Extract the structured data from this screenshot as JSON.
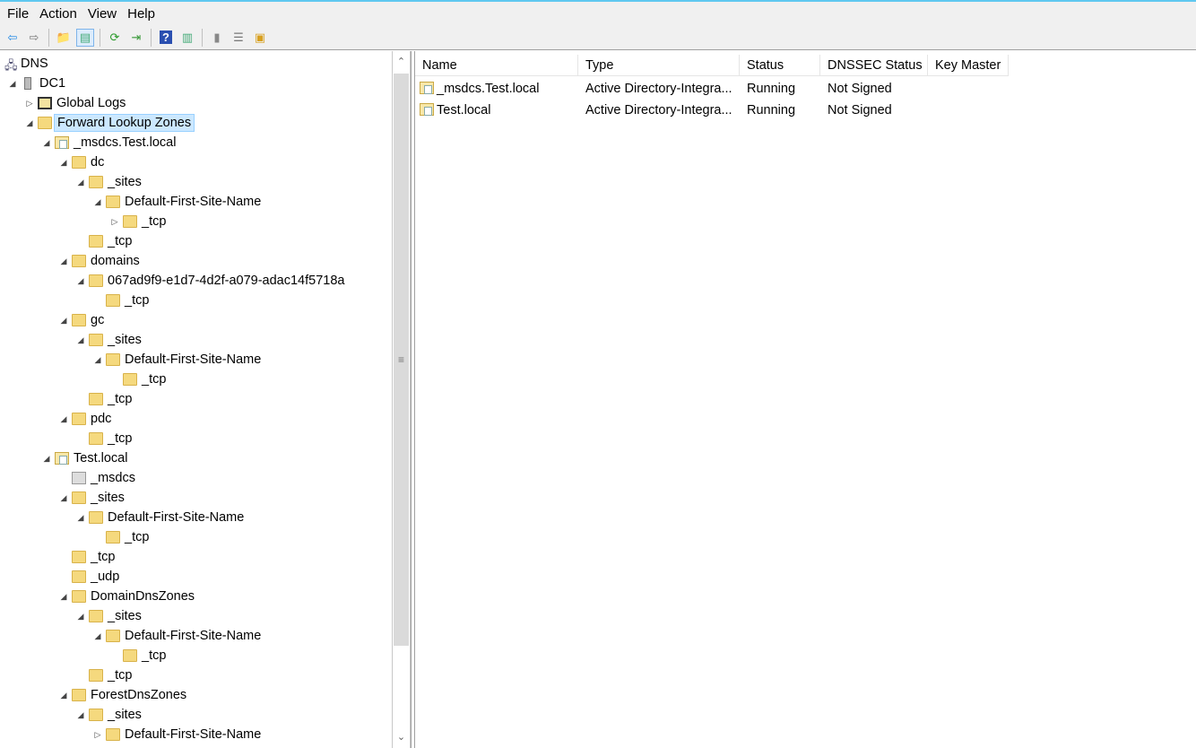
{
  "menu": [
    "File",
    "Action",
    "View",
    "Help"
  ],
  "toolbar": [
    {
      "icon": "back-arrow-icon",
      "glyph": "⇦",
      "color": "#1e88e5"
    },
    {
      "icon": "forward-arrow-icon",
      "glyph": "⇨",
      "color": "#777"
    },
    {
      "sep": true
    },
    {
      "icon": "up-folder-icon",
      "glyph": "📁",
      "color": "#d8a020"
    },
    {
      "icon": "show-hide-console-tree-icon",
      "glyph": "▤",
      "color": "#4a7",
      "active": true
    },
    {
      "sep": true
    },
    {
      "icon": "refresh-icon",
      "glyph": "⟳",
      "color": "#2a9a2a"
    },
    {
      "icon": "export-list-icon",
      "glyph": "⇥",
      "color": "#3a9a3a"
    },
    {
      "sep": true
    },
    {
      "icon": "help-icon",
      "glyph": "?",
      "color": "#fff",
      "bg": "#2a4fb0"
    },
    {
      "icon": "show-action-pane-icon",
      "glyph": "▥",
      "color": "#4a7"
    },
    {
      "sep": true
    },
    {
      "icon": "server-icon",
      "glyph": "▮",
      "color": "#888"
    },
    {
      "icon": "list-icon",
      "glyph": "☰",
      "color": "#777"
    },
    {
      "icon": "zone-icon",
      "glyph": "▣",
      "color": "#d8a020"
    }
  ],
  "tree": [
    {
      "label": "DNS",
      "level": 0,
      "exp": "none",
      "icon": "dns"
    },
    {
      "label": "DC1",
      "level": 1,
      "exp": "open",
      "icon": "server"
    },
    {
      "label": "Global Logs",
      "level": 2,
      "exp": "closed",
      "icon": "log"
    },
    {
      "label": "Forward Lookup Zones",
      "level": 2,
      "exp": "open",
      "icon": "folder",
      "selected": true
    },
    {
      "label": "_msdcs.Test.local",
      "level": 3,
      "exp": "open",
      "icon": "zone"
    },
    {
      "label": "dc",
      "level": 4,
      "exp": "open",
      "icon": "folder"
    },
    {
      "label": "_sites",
      "level": 5,
      "exp": "open",
      "icon": "folder"
    },
    {
      "label": "Default-First-Site-Name",
      "level": 6,
      "exp": "open",
      "icon": "folder"
    },
    {
      "label": "_tcp",
      "level": 7,
      "exp": "closed",
      "icon": "folder"
    },
    {
      "label": "_tcp",
      "level": 5,
      "exp": "none",
      "icon": "folder"
    },
    {
      "label": "domains",
      "level": 4,
      "exp": "open",
      "icon": "folder"
    },
    {
      "label": "067ad9f9-e1d7-4d2f-a079-adac14f5718a",
      "level": 5,
      "exp": "open",
      "icon": "folder"
    },
    {
      "label": "_tcp",
      "level": 6,
      "exp": "none",
      "icon": "folder"
    },
    {
      "label": "gc",
      "level": 4,
      "exp": "open",
      "icon": "folder"
    },
    {
      "label": "_sites",
      "level": 5,
      "exp": "open",
      "icon": "folder"
    },
    {
      "label": "Default-First-Site-Name",
      "level": 6,
      "exp": "open",
      "icon": "folder"
    },
    {
      "label": "_tcp",
      "level": 7,
      "exp": "none",
      "icon": "folder"
    },
    {
      "label": "_tcp",
      "level": 5,
      "exp": "none",
      "icon": "folder"
    },
    {
      "label": "pdc",
      "level": 4,
      "exp": "open",
      "icon": "folder"
    },
    {
      "label": "_tcp",
      "level": 5,
      "exp": "none",
      "icon": "folder"
    },
    {
      "label": "Test.local",
      "level": 3,
      "exp": "open",
      "icon": "zone"
    },
    {
      "label": "_msdcs",
      "level": 4,
      "exp": "none",
      "icon": "deleg"
    },
    {
      "label": "_sites",
      "level": 4,
      "exp": "open",
      "icon": "folder"
    },
    {
      "label": "Default-First-Site-Name",
      "level": 5,
      "exp": "open",
      "icon": "folder"
    },
    {
      "label": "_tcp",
      "level": 6,
      "exp": "none",
      "icon": "folder"
    },
    {
      "label": "_tcp",
      "level": 4,
      "exp": "none",
      "icon": "folder"
    },
    {
      "label": "_udp",
      "level": 4,
      "exp": "none",
      "icon": "folder"
    },
    {
      "label": "DomainDnsZones",
      "level": 4,
      "exp": "open",
      "icon": "folder"
    },
    {
      "label": "_sites",
      "level": 5,
      "exp": "open",
      "icon": "folder"
    },
    {
      "label": "Default-First-Site-Name",
      "level": 6,
      "exp": "open",
      "icon": "folder"
    },
    {
      "label": "_tcp",
      "level": 7,
      "exp": "none",
      "icon": "folder"
    },
    {
      "label": "_tcp",
      "level": 5,
      "exp": "none",
      "icon": "folder"
    },
    {
      "label": "ForestDnsZones",
      "level": 4,
      "exp": "open",
      "icon": "folder"
    },
    {
      "label": "_sites",
      "level": 5,
      "exp": "open",
      "icon": "folder"
    },
    {
      "label": "Default-First-Site-Name",
      "level": 6,
      "exp": "closed",
      "icon": "folder"
    }
  ],
  "scrollbar": {
    "up": "^",
    "down": "v",
    "grip": "≡"
  },
  "list": {
    "columns": [
      "Name",
      "Type",
      "Status",
      "DNSSEC Status",
      "Key Master"
    ],
    "rows": [
      [
        "_msdcs.Test.local",
        "Active Directory-Integra...",
        "Running",
        "Not Signed",
        ""
      ],
      [
        "Test.local",
        "Active Directory-Integra...",
        "Running",
        "Not Signed",
        ""
      ]
    ]
  }
}
